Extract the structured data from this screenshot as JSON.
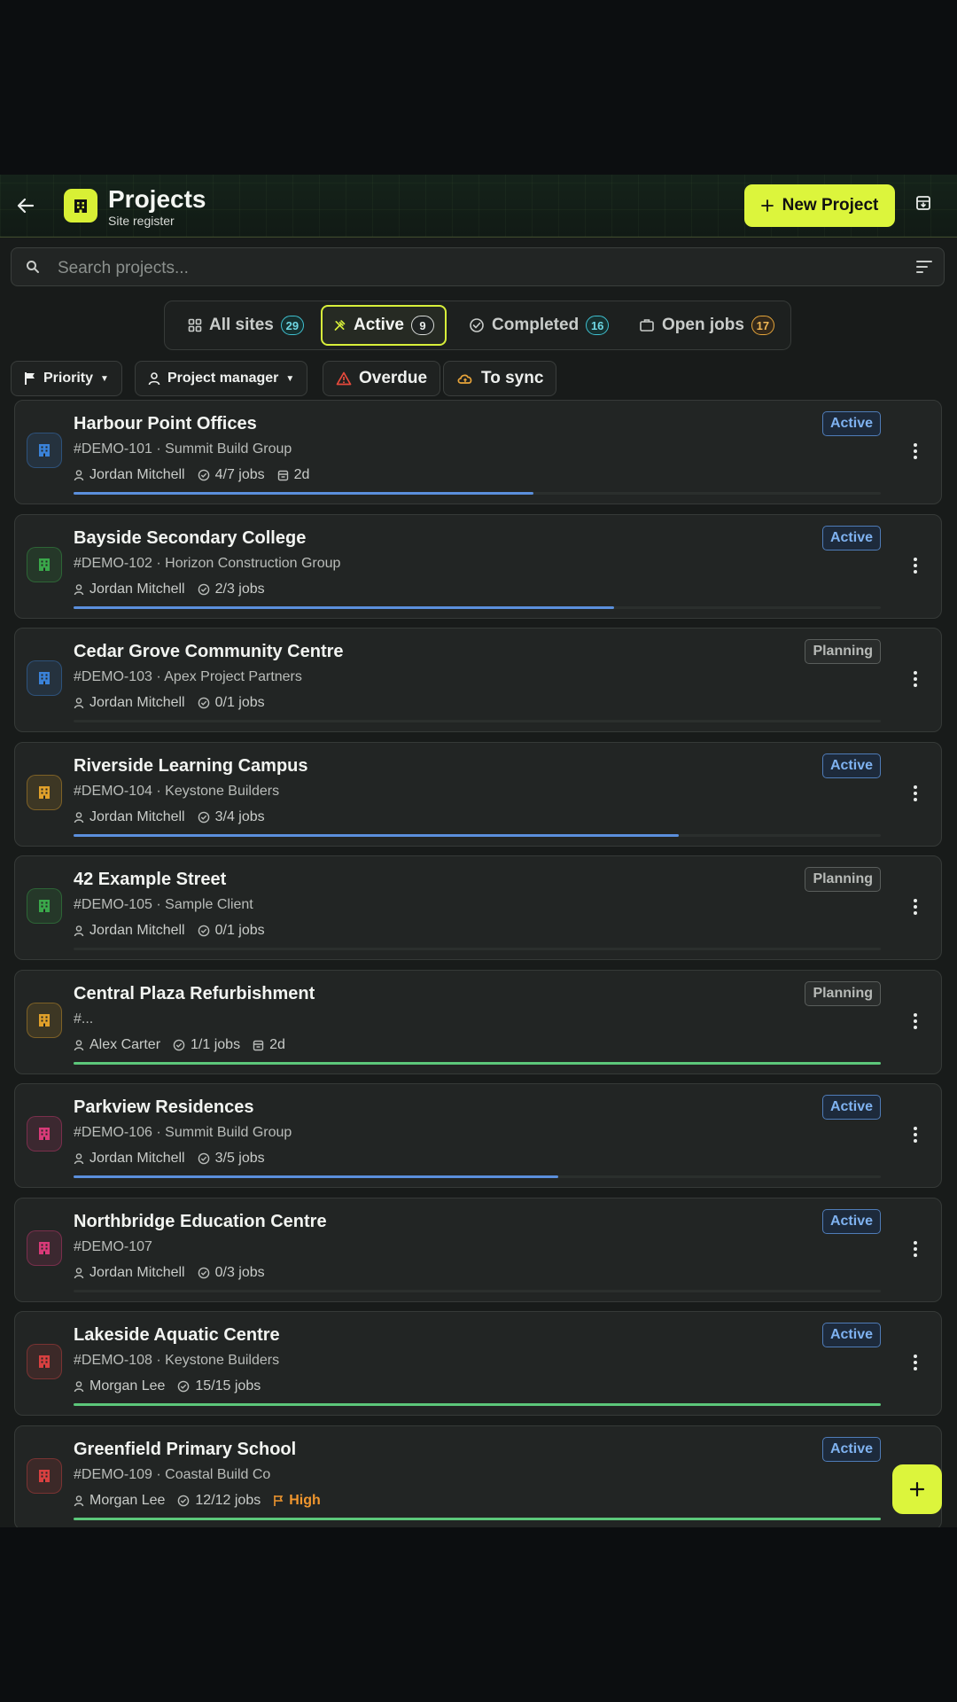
{
  "header": {
    "title": "Projects",
    "subtitle": "Site register",
    "new_button_label": "New Project"
  },
  "search": {
    "placeholder": "Search projects...",
    "value": ""
  },
  "tabs": [
    {
      "label": "All sites",
      "count": "29",
      "icon": "grid-icon",
      "badge_color": "#3fc0d0"
    },
    {
      "label": "Active",
      "count": "9",
      "icon": "tools-icon",
      "badge_color": "#d9dcd9",
      "selected": true
    },
    {
      "label": "Completed",
      "count": "16",
      "icon": "check-circle-icon",
      "badge_color": "#3fc0d0"
    },
    {
      "label": "Open jobs",
      "count": "17",
      "icon": "briefcase-icon",
      "badge_color": "#e4a43a"
    }
  ],
  "filters": [
    {
      "label": "Priority",
      "icon": "flag-icon",
      "dropdown": true
    },
    {
      "label": "Project manager",
      "icon": "person-icon",
      "dropdown": true
    },
    {
      "label": "Overdue",
      "icon": "warning-icon",
      "dropdown": false
    },
    {
      "label": "To sync",
      "icon": "cloud-sync-icon",
      "dropdown": false
    }
  ],
  "projects": [
    {
      "name": "Harbour Point Offices",
      "sub": "#DEMO-101 · Summit Build Group",
      "manager": "Jordan Mitchell",
      "jobs": "4/7 jobs",
      "extra": "2d",
      "status": "Active",
      "icon_color": "#3a82d8",
      "progress": 0.57,
      "bar_color": "#5b8fdc"
    },
    {
      "name": "Bayside Secondary College",
      "sub": "#DEMO-102 · Horizon Construction Group",
      "manager": "Jordan Mitchell",
      "jobs": "2/3 jobs",
      "status": "Active",
      "icon_color": "#3aa84a",
      "progress": 0.67,
      "bar_color": "#5b8fdc"
    },
    {
      "name": "Cedar Grove Community Centre",
      "sub": "#DEMO-103 · Apex Project Partners",
      "manager": "Jordan Mitchell",
      "jobs": "0/1 jobs",
      "status": "Planning",
      "icon_color": "#3a82d8",
      "progress": 0,
      "bar_color": "#5b8fdc"
    },
    {
      "name": "Riverside Learning Campus",
      "sub": "#DEMO-104 · Keystone Builders",
      "manager": "Jordan Mitchell",
      "jobs": "3/4 jobs",
      "status": "Active",
      "icon_color": "#e0a02a",
      "progress": 0.75,
      "bar_color": "#5b8fdc"
    },
    {
      "name": "42 Example Street",
      "sub": "#DEMO-105 · Sample Client",
      "manager": "Jordan Mitchell",
      "jobs": "0/1 jobs",
      "status": "Planning",
      "icon_color": "#3aa84a",
      "progress": 0,
      "bar_color": "#5b8fdc"
    },
    {
      "name": "Central Plaza Refurbishment",
      "sub": "#...",
      "manager": "Alex Carter",
      "jobs": "1/1 jobs",
      "extra": "2d",
      "status": "Planning",
      "icon_color": "#e0a02a",
      "progress": 1,
      "bar_color": "#5cc77a"
    },
    {
      "name": "Parkview Residences",
      "sub": "#DEMO-106 · Summit Build Group",
      "manager": "Jordan Mitchell",
      "jobs": "3/5 jobs",
      "status": "Active",
      "icon_color": "#d83a78",
      "progress": 0.6,
      "bar_color": "#5b8fdc"
    },
    {
      "name": "Northbridge Education Centre",
      "sub": "#DEMO-107",
      "manager": "Jordan Mitchell",
      "jobs": "0/3 jobs",
      "status": "Active",
      "icon_color": "#d83a78",
      "progress": 0,
      "bar_color": "#5b8fdc"
    },
    {
      "name": "Lakeside Aquatic Centre",
      "sub": "#DEMO-108 · Keystone Builders",
      "manager": "Morgan Lee",
      "jobs": "15/15 jobs",
      "status": "Active",
      "icon_color": "#d84040",
      "progress": 1,
      "bar_color": "#5cc77a"
    },
    {
      "name": "Greenfield Primary School",
      "sub": "#DEMO-109 · Coastal Build Co",
      "manager": "Morgan Lee",
      "jobs": "12/12 jobs",
      "priority": "High",
      "priority_color": "#f0962e",
      "status": "Active",
      "icon_color": "#d84040",
      "progress": 1,
      "bar_color": "#5cc77a"
    }
  ],
  "colors": {
    "accent": "#dcf53c",
    "background": "#181b1a",
    "active_status": "#7fb2f0"
  }
}
